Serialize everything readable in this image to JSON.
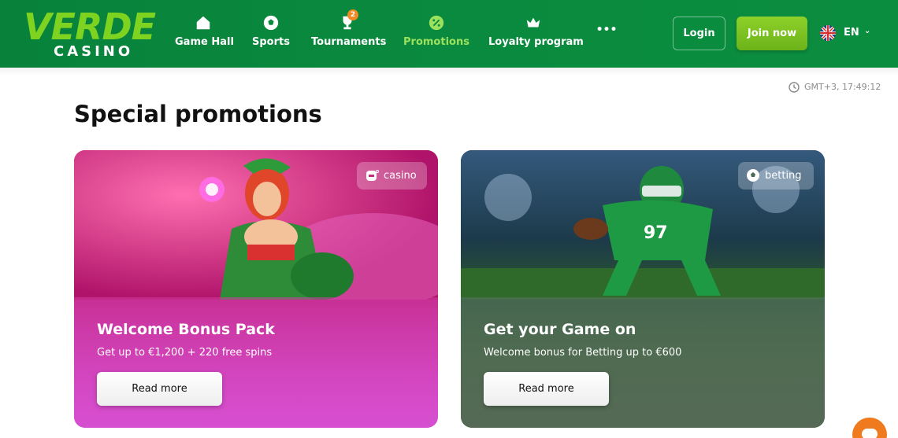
{
  "brand": {
    "name": "VERDE",
    "sub": "CASINO",
    "primary_color": "#0a8a3e",
    "accent_color": "#7ed321"
  },
  "nav": {
    "items": [
      {
        "label": "Game Hall",
        "icon": "home-icon"
      },
      {
        "label": "Sports",
        "icon": "soccer-ball-icon"
      },
      {
        "label": "Tournaments",
        "icon": "trophy-icon",
        "badge": "2"
      },
      {
        "label": "Promotions",
        "icon": "percent-badge-icon",
        "active": true
      },
      {
        "label": "Loyalty program",
        "icon": "crown-icon"
      }
    ],
    "more_label": "•••"
  },
  "header": {
    "login_label": "Login",
    "join_label": "Join now",
    "language": "EN"
  },
  "clock": {
    "text": "GMT+3, 17:49:12"
  },
  "page": {
    "title": "Special promotions"
  },
  "promotions": [
    {
      "tag": "casino",
      "tag_icon": "slot-machine-icon",
      "title": "Welcome Bonus Pack",
      "subtitle": "Get up to €1,200 + 220 free spins",
      "button": "Read more",
      "accent_color": "#c21a6e"
    },
    {
      "tag": "betting",
      "tag_icon": "soccer-ball-icon",
      "title": "Get your Game on",
      "subtitle": "Welcome bonus for Betting up to €600",
      "button": "Read more",
      "accent_color": "#2f5a3a"
    }
  ]
}
